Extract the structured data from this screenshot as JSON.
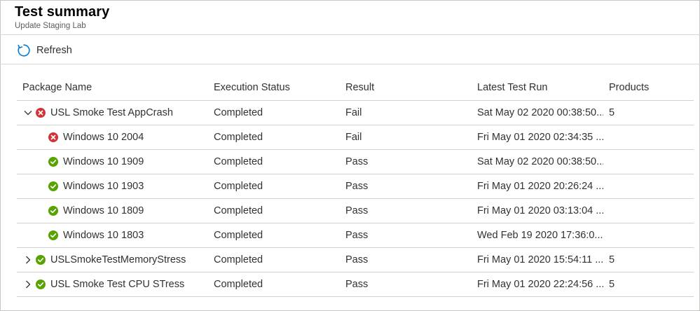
{
  "page": {
    "title": "Test summary",
    "subtitle": "Update Staging Lab"
  },
  "toolbar": {
    "refresh_label": "Refresh",
    "refresh_icon": "refresh-icon"
  },
  "colors": {
    "accent": "#0078d4",
    "fail": "#d13438",
    "pass": "#57a300",
    "border": "#d2d0ce"
  },
  "table": {
    "columns": [
      "Package Name",
      "Execution Status",
      "Result",
      "Latest Test Run",
      "Products"
    ],
    "rows": [
      {
        "level": "parent",
        "expanded": true,
        "status": "fail",
        "name": "USL Smoke Test AppCrash",
        "execution": "Completed",
        "result": "Fail",
        "latest": "Sat May 02 2020 00:38:50...",
        "products": "5"
      },
      {
        "level": "child",
        "status": "fail",
        "name": "Windows 10 2004",
        "execution": "Completed",
        "result": "Fail",
        "latest": "Fri May 01 2020 02:34:35 ...",
        "products": ""
      },
      {
        "level": "child",
        "status": "pass",
        "name": "Windows 10 1909",
        "execution": "Completed",
        "result": "Pass",
        "latest": "Sat May 02 2020 00:38:50...",
        "products": ""
      },
      {
        "level": "child",
        "status": "pass",
        "name": "Windows 10 1903",
        "execution": "Completed",
        "result": "Pass",
        "latest": "Fri May 01 2020 20:26:24 ...",
        "products": ""
      },
      {
        "level": "child",
        "status": "pass",
        "name": "Windows 10 1809",
        "execution": "Completed",
        "result": "Pass",
        "latest": "Fri May 01 2020 03:13:04 ...",
        "products": ""
      },
      {
        "level": "child",
        "status": "pass",
        "name": "Windows 10 1803",
        "execution": "Completed",
        "result": "Pass",
        "latest": "Wed Feb 19 2020 17:36:0...",
        "products": ""
      },
      {
        "level": "parent",
        "expanded": false,
        "status": "pass",
        "name": "USLSmokeTestMemoryStress",
        "execution": "Completed",
        "result": "Pass",
        "latest": "Fri May 01 2020 15:54:11 ...",
        "products": "5"
      },
      {
        "level": "parent",
        "expanded": false,
        "status": "pass",
        "name": "USL Smoke Test CPU STress",
        "execution": "Completed",
        "result": "Pass",
        "latest": "Fri May 01 2020 22:24:56 ...",
        "products": "5"
      }
    ]
  }
}
